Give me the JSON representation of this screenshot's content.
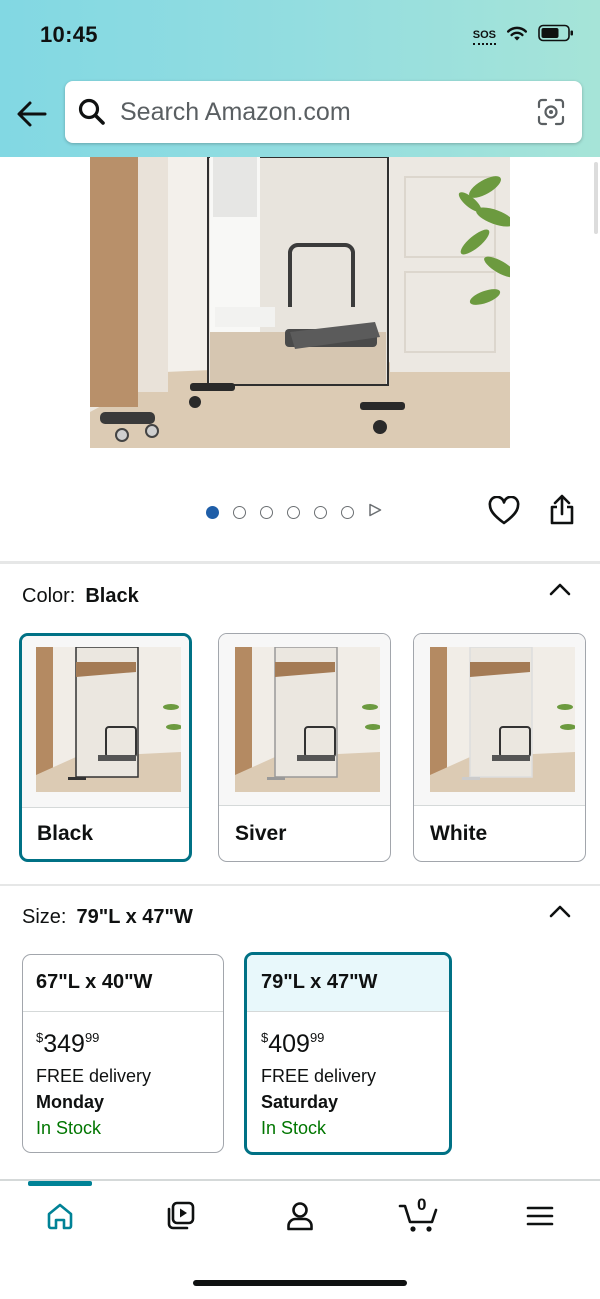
{
  "status_bar": {
    "time": "10:45",
    "sos": "SOS"
  },
  "search": {
    "placeholder": "Search Amazon.com"
  },
  "carousel": {
    "total_dots": 6,
    "active_index": 0
  },
  "color_section": {
    "label": "Color:",
    "selected": "Black",
    "options": [
      {
        "name": "Black",
        "selected": true
      },
      {
        "name": "Siver",
        "selected": false
      },
      {
        "name": "White",
        "selected": false
      }
    ]
  },
  "size_section": {
    "label": "Size:",
    "selected": "79\"L x 47\"W",
    "options": [
      {
        "title": "67\"L x 40\"W",
        "currency": "$",
        "price_whole": "349",
        "price_cents": "99",
        "delivery": "FREE delivery",
        "day": "Monday",
        "stock": "In Stock",
        "selected": false
      },
      {
        "title": "79\"L x 47\"W",
        "currency": "$",
        "price_whole": "409",
        "price_cents": "99",
        "delivery": "FREE delivery",
        "day": "Saturday",
        "stock": "In Stock",
        "selected": true
      }
    ]
  },
  "tabbar": {
    "cart_count": "0",
    "items": [
      "home-icon",
      "video-icon",
      "account-icon",
      "cart-icon",
      "menu-icon"
    ],
    "active": "home-icon"
  },
  "colors": {
    "accent_teal": "#007185",
    "in_stock_green": "#007600",
    "active_dot": "#1f5ea8"
  }
}
